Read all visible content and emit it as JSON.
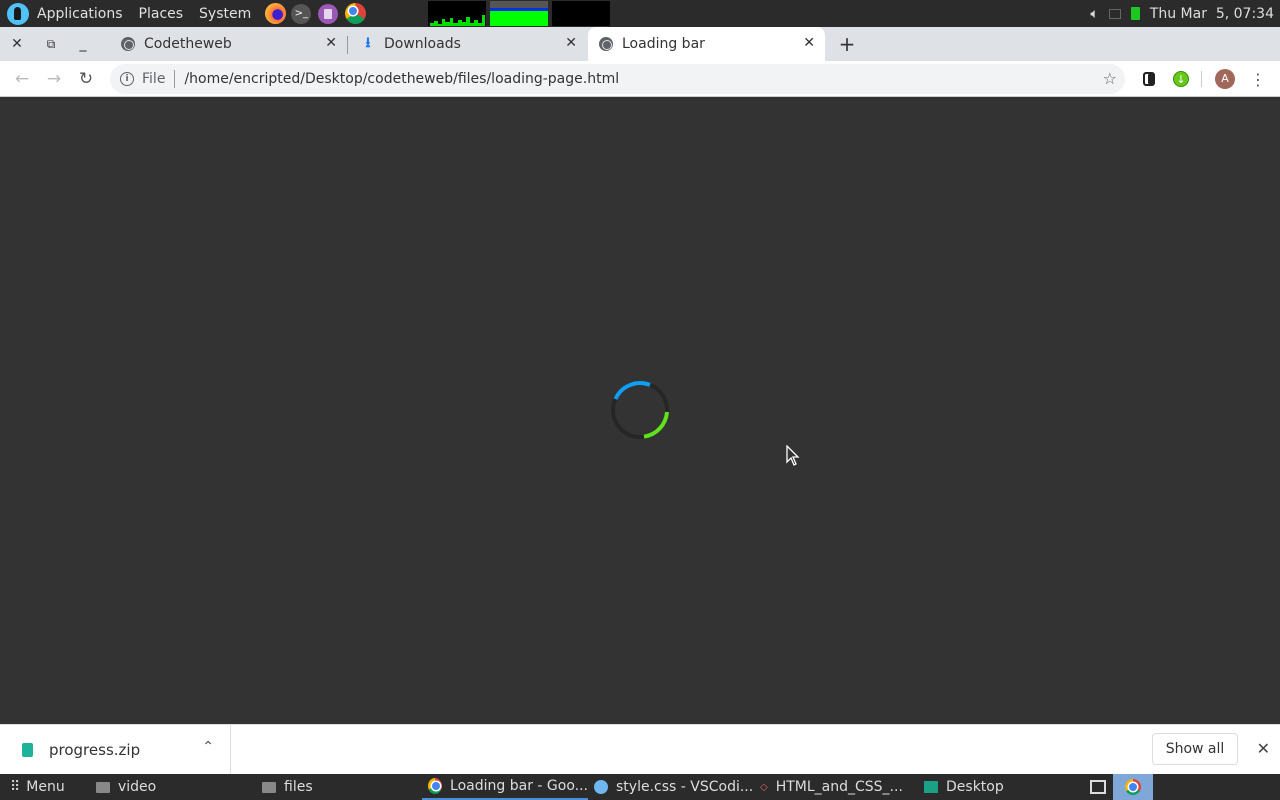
{
  "topbar": {
    "menus": [
      "Applications",
      "Places",
      "System"
    ],
    "launchers": [
      {
        "name": "firefox",
        "color": "#ff7139"
      },
      {
        "name": "terminal",
        "color": "#555555",
        "glyph": ">_"
      },
      {
        "name": "text-editor",
        "color": "#9b59b6"
      },
      {
        "name": "chrome",
        "color": "#4285f4"
      }
    ],
    "clock": "Thu Mar  5, 07:34"
  },
  "browser": {
    "tabs": [
      {
        "title": "Codetheweb",
        "icon": "globe-icon",
        "active": false
      },
      {
        "title": "Downloads",
        "icon": "download-icon",
        "active": false
      },
      {
        "title": "Loading bar",
        "icon": "globe-icon",
        "active": true
      }
    ],
    "new_tab_label": "+",
    "address": {
      "scheme": "File",
      "url": "/home/encripted/Desktop/codetheweb/files/loading-page.html"
    },
    "profile_initial": "A"
  },
  "page": {
    "spinner": {
      "colors": {
        "track": "#262626",
        "primary": "#0fa0f5",
        "secondary": "#5ee21a"
      }
    }
  },
  "downloads": {
    "items": [
      {
        "name": "progress.zip"
      }
    ],
    "show_all_label": "Show all"
  },
  "taskbar": {
    "menu_label": "Menu",
    "tasks": [
      {
        "label": "video",
        "icon": "folder-icon"
      },
      {
        "label": "files",
        "icon": "folder-icon"
      },
      {
        "label": "Loading bar - Goo...",
        "icon": "chrome-icon",
        "active": true
      },
      {
        "label": "style.css - VSCodi...",
        "icon": "vscodium-icon"
      },
      {
        "label": "HTML_and_CSS_...",
        "icon": "app-icon"
      },
      {
        "label": "Desktop",
        "icon": "desktop-icon"
      }
    ]
  }
}
